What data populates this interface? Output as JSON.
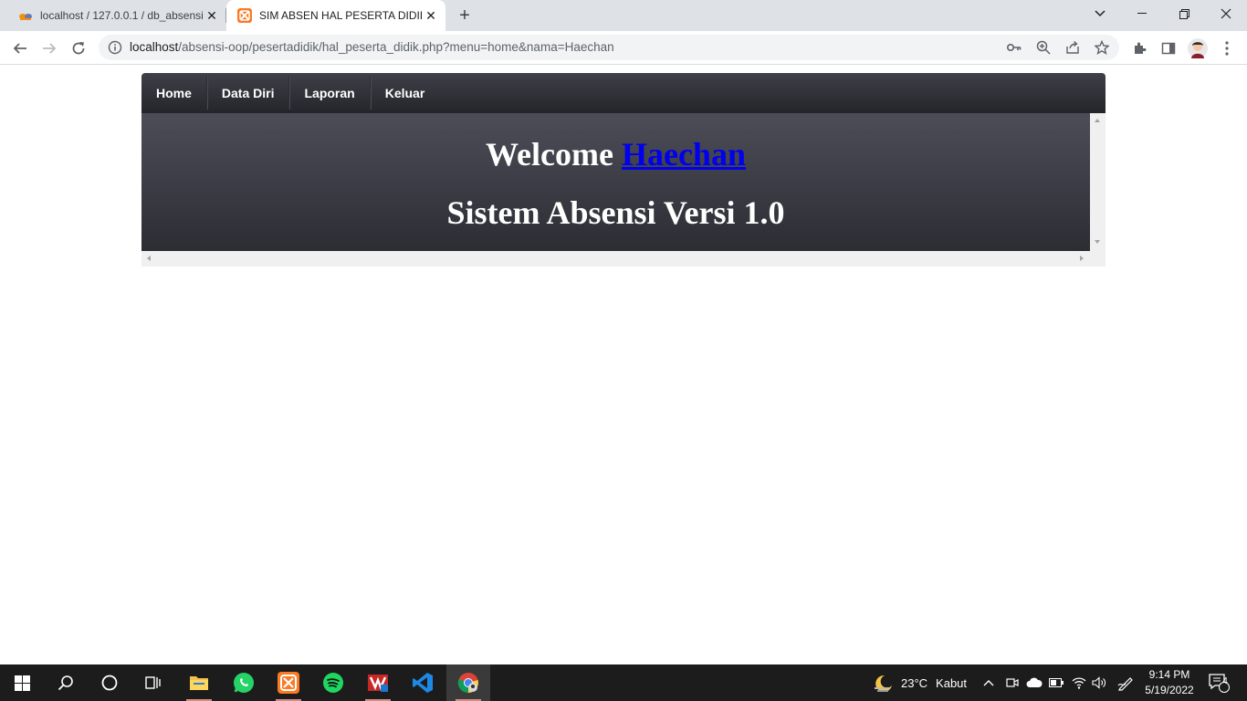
{
  "browser": {
    "tabs": [
      {
        "title": "localhost / 127.0.0.1 / db_absensi",
        "active": false,
        "icon": "phpmyadmin-icon"
      },
      {
        "title": "SIM ABSEN HAL PESERTA DIDIK",
        "active": true,
        "icon": "xampp-icon"
      }
    ],
    "url_host": "localhost",
    "url_path": "/absensi-oop/pesertadidik/hal_peserta_didik.php?menu=home&nama=Haechan"
  },
  "nav": {
    "items": [
      "Home",
      "Data Diri",
      "Laporan",
      "Keluar"
    ]
  },
  "content": {
    "welcome_prefix": "Welcome",
    "username": "Haechan",
    "subtitle": "Sistem Absensi Versi 1.0"
  },
  "taskbar": {
    "weather_temp": "23°C",
    "weather_desc": "Kabut",
    "time": "9:14 PM",
    "date": "5/19/2022",
    "notification_count": "4"
  },
  "colors": {
    "nav_bg": "#2c2d33",
    "link": "#0000ee",
    "taskbar_bg": "#1c1c1c"
  }
}
